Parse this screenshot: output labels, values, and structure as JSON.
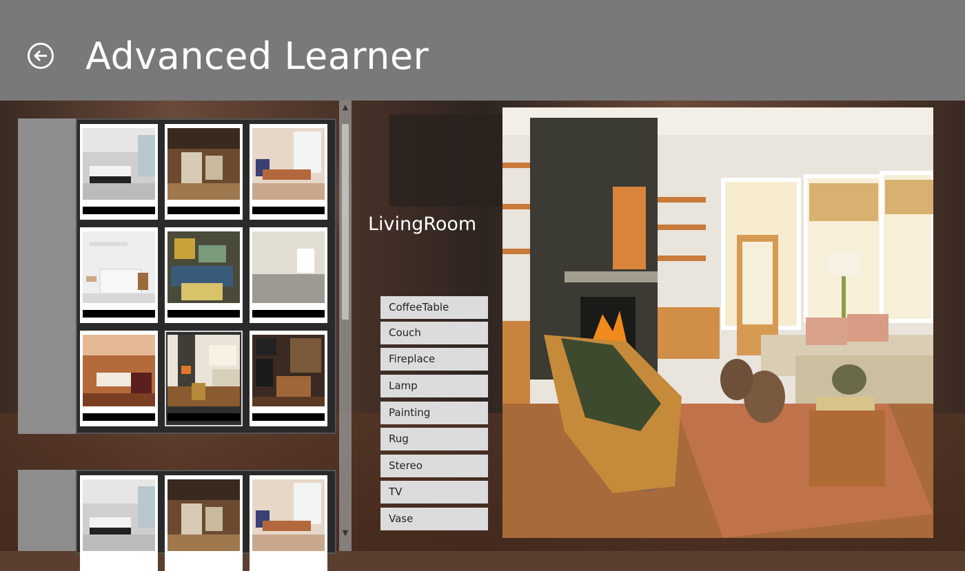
{
  "header": {
    "title": "Advanced Learner",
    "back_icon": "back-arrow-icon"
  },
  "groups": [
    {
      "tiles": [
        {
          "scene": "bedroom"
        },
        {
          "scene": "cluttered-basement"
        },
        {
          "scene": "dining-room"
        },
        {
          "scene": "bathroom"
        },
        {
          "scene": "cluttered-garage"
        },
        {
          "scene": "empty-room"
        },
        {
          "scene": "kitchen"
        },
        {
          "scene": "living-room",
          "selected": true
        },
        {
          "scene": "cluttered-living-room"
        }
      ]
    },
    {
      "tiles": [
        {
          "scene": "bedroom"
        },
        {
          "scene": "cluttered-basement"
        },
        {
          "scene": "dining-room"
        }
      ]
    }
  ],
  "detail": {
    "category": "LivingRoom",
    "objects": [
      "CoffeeTable",
      "Couch",
      "Fireplace",
      "Lamp",
      "Painting",
      "Rug",
      "Stereo",
      "TV",
      "Vase"
    ]
  },
  "colors": {
    "header": "#797979",
    "panel": "#8d8d8d",
    "grid": "#2a2a2a",
    "button": "#dcdcdc"
  }
}
